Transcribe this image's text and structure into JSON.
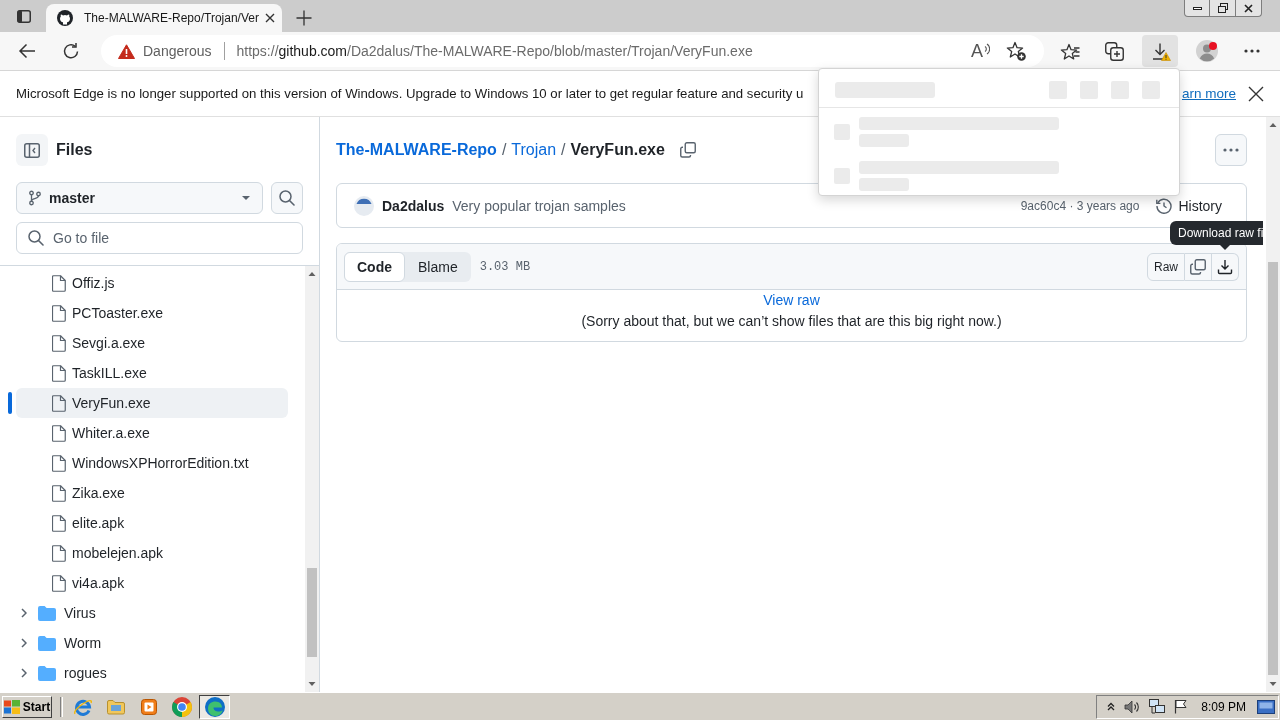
{
  "browser": {
    "tabs": [
      {
        "title": "The-MALWARE-Repo/Trojan/Ver",
        "selected": true
      }
    ],
    "address_bar": {
      "security_label": "Dangerous",
      "url": {
        "scheme": "https://",
        "host": "github.com",
        "path": "/Da2dalus/The-MALWARE-Repo/blob/master/Trojan/VeryFun.exe"
      },
      "read_aloud": "A"
    },
    "toolbar": {
      "downloads_warning": true,
      "profile_notification": true
    },
    "downloads_flyout": {
      "open": true
    },
    "infobar": {
      "message": "Microsoft Edge is no longer supported on this version of Windows. Upgrade to Windows 10 or later to get regular feature and security u",
      "link": "arn more"
    }
  },
  "page": {
    "sidebar": {
      "title": "Files",
      "branch": "master",
      "filter_placeholder": "Go to file",
      "tree": [
        {
          "kind": "continued",
          "children": [
            {
              "kind": "file",
              "name": "Offiz.js",
              "selected": false
            },
            {
              "kind": "file",
              "name": "PCToaster.exe",
              "selected": false
            },
            {
              "kind": "file",
              "name": "Sevgi.a.exe",
              "selected": false
            },
            {
              "kind": "file",
              "name": "TaskILL.exe",
              "selected": false
            },
            {
              "kind": "file",
              "name": "VeryFun.exe",
              "selected": true
            },
            {
              "kind": "file",
              "name": "Whiter.a.exe",
              "selected": false
            },
            {
              "kind": "file",
              "name": "WindowsXPHorrorEdition.txt",
              "selected": false
            },
            {
              "kind": "file",
              "name": "Zika.exe",
              "selected": false
            },
            {
              "kind": "file",
              "name": "elite.apk",
              "selected": false
            },
            {
              "kind": "file",
              "name": "mobelejen.apk",
              "selected": false
            },
            {
              "kind": "file",
              "name": "vi4a.apk",
              "selected": false
            }
          ]
        },
        {
          "kind": "folder",
          "name": "Virus",
          "expanded": false,
          "selected": false
        },
        {
          "kind": "folder",
          "name": "Worm",
          "expanded": false,
          "selected": false
        },
        {
          "kind": "folder",
          "name": "rogues",
          "expanded": false,
          "selected": false
        }
      ]
    },
    "main": {
      "breadcrumb": [
        {
          "kind": "repo",
          "text": "The-MALWARE-Repo"
        },
        {
          "kind": "separator",
          "text": "/"
        },
        {
          "kind": "link",
          "text": "Trojan"
        },
        {
          "kind": "separator",
          "text": "/"
        },
        {
          "kind": "current",
          "text": "VeryFun.exe"
        }
      ],
      "commit": {
        "author": "Da2dalus",
        "message": "Very popular trojan samples",
        "meta": "9ac60c4 · 3 years ago",
        "history": "History"
      },
      "file": {
        "view_tabs": [
          {
            "label": "Code",
            "selected": true
          },
          {
            "label": "Blame",
            "selected": false
          }
        ],
        "size": "3.03 MB",
        "raw": "Raw",
        "tooltip": "Download raw fi",
        "view_raw": "View raw",
        "notice": "(Sorry about that, but we can’t show files that are this big right now.)"
      }
    }
  },
  "taskbar": {
    "start": "Start",
    "items": [
      {
        "kind": "ie",
        "selected": false
      },
      {
        "kind": "explorer",
        "selected": false
      },
      {
        "kind": "media",
        "selected": false
      },
      {
        "kind": "chrome",
        "selected": false
      },
      {
        "kind": "edge",
        "selected": true
      }
    ],
    "clock": "8:09 PM"
  }
}
